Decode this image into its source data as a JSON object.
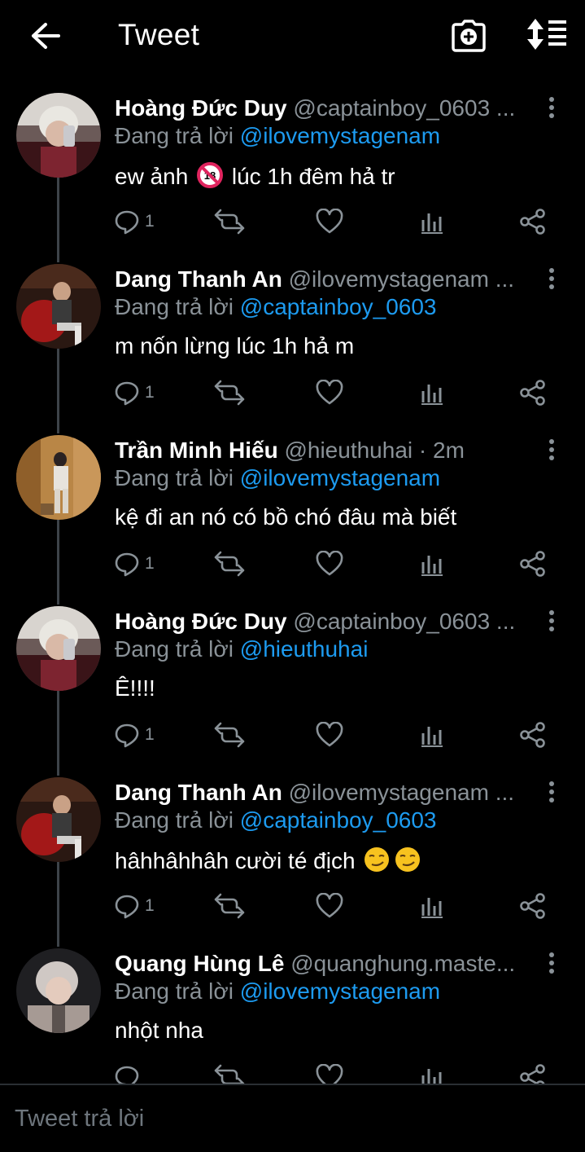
{
  "header": {
    "title": "Tweet",
    "back_icon": "arrow-left-icon",
    "camera_icon": "camera-plus-icon",
    "sort_icon": "sort-icon"
  },
  "reply_prefix": "Đang trả lời",
  "tweets": [
    {
      "name": "Hoàng Đức Duy",
      "handle": "@captainboy_0603 ...",
      "reply_to": "@ilovemystagenam",
      "text": "ew ảnh",
      "text_after": "lúc 1h đêm hả tr",
      "reply_count": "1"
    },
    {
      "name": "Dang Thanh An",
      "handle": "@ilovemystagenam ...",
      "reply_to": "@captainboy_0603",
      "text": "m nốn lừng lúc 1h hả m",
      "text_after": "",
      "reply_count": "1"
    },
    {
      "name": "Trần Minh Hiếu",
      "handle": "@hieuthuhai · 2m",
      "reply_to": "@ilovemystagenam",
      "text": "kệ đi an nó có bồ chó đâu mà biết",
      "text_after": "",
      "reply_count": "1"
    },
    {
      "name": "Hoàng Đức Duy",
      "handle": "@captainboy_0603 ...",
      "reply_to": "@hieuthuhai",
      "text": "Ê!!!!",
      "text_after": "",
      "reply_count": "1"
    },
    {
      "name": "Dang Thanh An",
      "handle": "@ilovemystagenam ...",
      "reply_to": "@captainboy_0603",
      "text": "hâhhâhhâh cười té địch",
      "text_after": "",
      "reply_count": "1"
    },
    {
      "name": "Quang Hùng Lê",
      "handle": "@quanghung.maste...",
      "reply_to": "@ilovemystagenam",
      "text": "nhột nha",
      "text_after": "",
      "reply_count": ""
    }
  ],
  "footer": {
    "placeholder": "Tweet trả lời"
  },
  "colors": {
    "background": "#000000",
    "accent": "#1d9bf0",
    "muted": "#8a9298"
  }
}
